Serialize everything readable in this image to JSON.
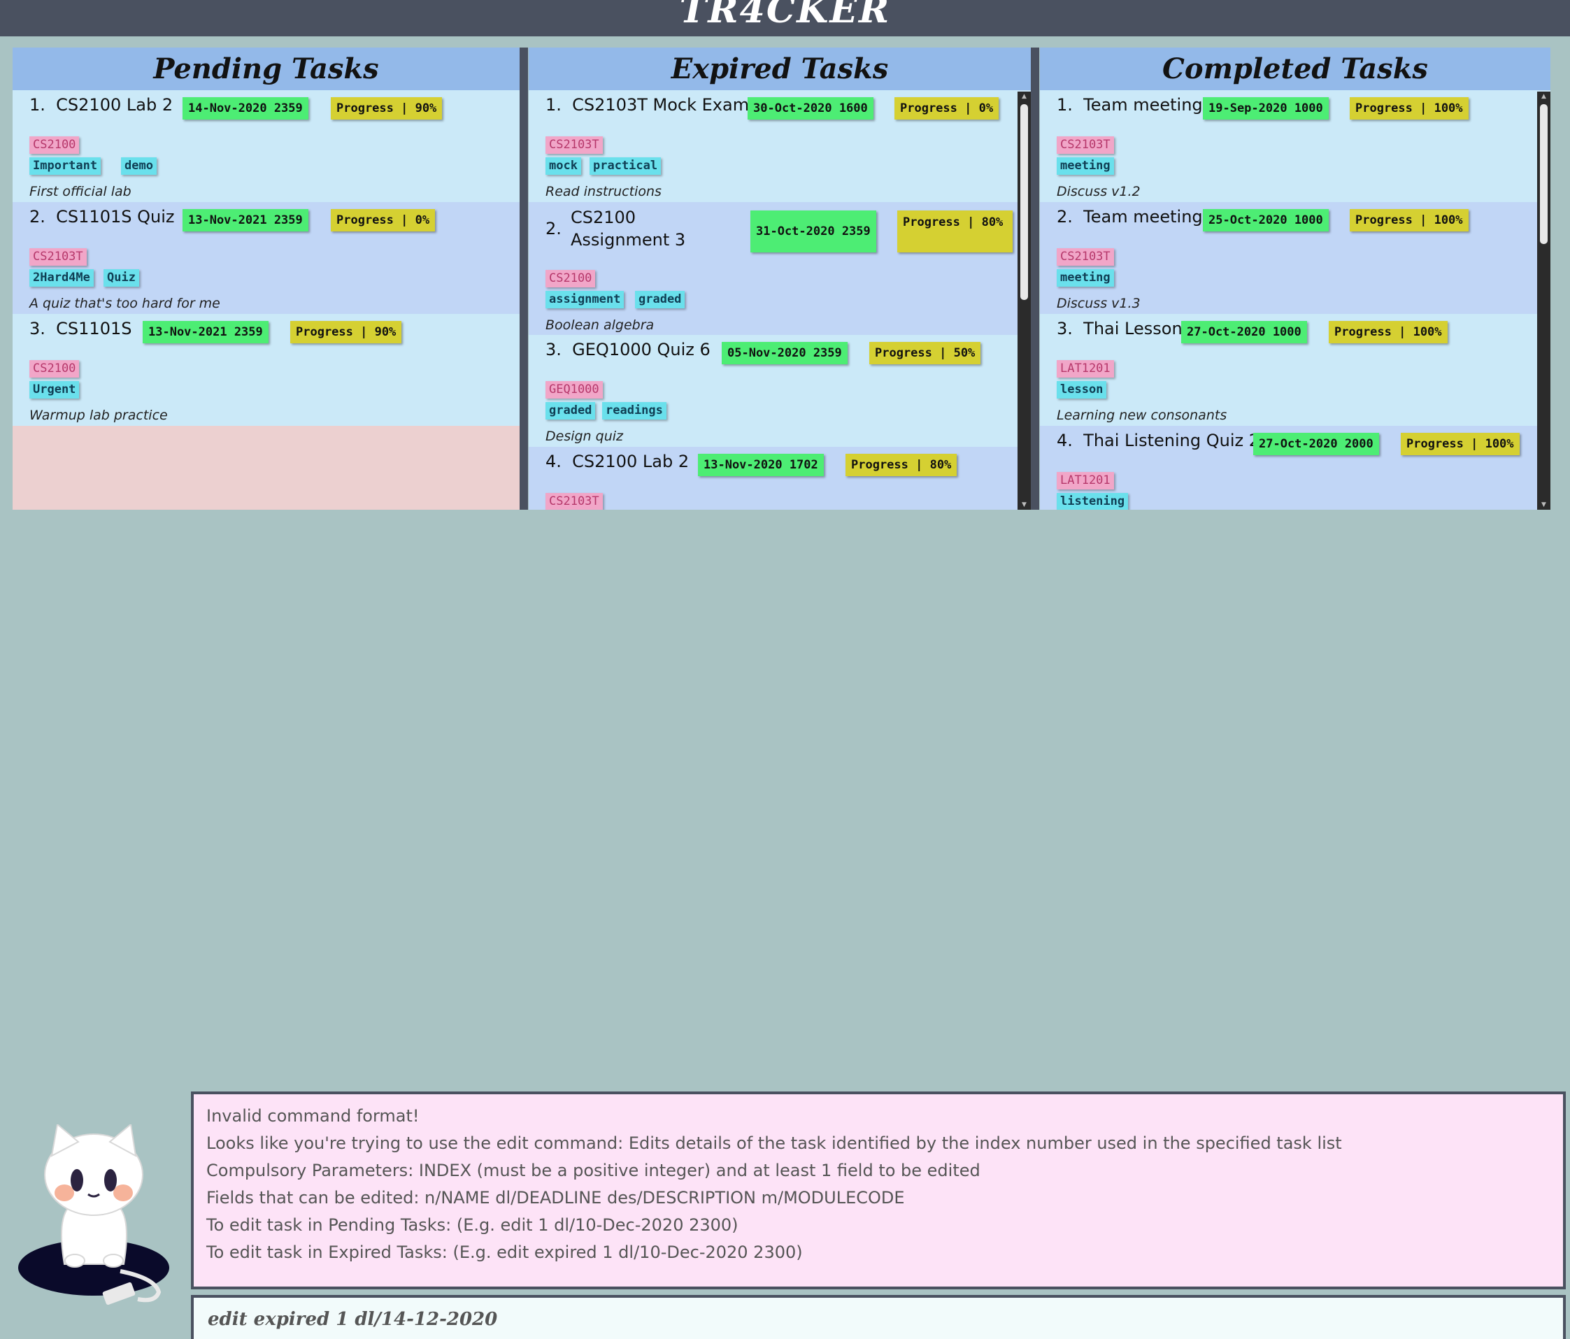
{
  "app": {
    "title": "TR4CKER"
  },
  "pending": {
    "title": "Pending Tasks",
    "tasks": [
      {
        "index": "1.",
        "name": "CS2100 Lab 2",
        "deadline": "14-Nov-2020 2359",
        "progress": "Progress | 90%",
        "module": "CS2100",
        "tags": [
          "Important",
          "demo"
        ],
        "description": "First official lab"
      },
      {
        "index": "2.",
        "name": "CS1101S Quiz",
        "deadline": "13-Nov-2021 2359",
        "progress": "Progress | 0%",
        "module": "CS2103T",
        "tags": [
          "2Hard4Me",
          "Quiz"
        ],
        "description": "A quiz that's too hard for me"
      },
      {
        "index": "3.",
        "name": "CS1101S",
        "deadline": "13-Nov-2021 2359",
        "progress": "Progress | 90%",
        "module": "CS2100",
        "tags": [
          "Urgent"
        ],
        "description": "Warmup lab practice"
      }
    ]
  },
  "expired": {
    "title": "Expired Tasks",
    "tasks": [
      {
        "index": "1.",
        "name": "CS2103T Mock Exam",
        "deadline": "30-Oct-2020 1600",
        "progress": "Progress | 0%",
        "module": "CS2103T",
        "tags": [
          "mock",
          "practical"
        ],
        "description": "Read instructions"
      },
      {
        "index": "2.",
        "name": "CS2100 Assignment 3",
        "deadline": "31-Oct-2020 2359",
        "progress": "Progress | 80%",
        "module": "CS2100",
        "tags": [
          "assignment",
          "graded"
        ],
        "description": "Boolean algebra"
      },
      {
        "index": "3.",
        "name": "GEQ1000 Quiz 6",
        "deadline": "05-Nov-2020 2359",
        "progress": "Progress | 50%",
        "module": "GEQ1000",
        "tags": [
          "graded",
          "readings"
        ],
        "description": "Design quiz"
      },
      {
        "index": "4.",
        "name": "CS2100 Lab 2",
        "deadline": "13-Nov-2020 1702",
        "progress": "Progress | 80%",
        "module": "CS2103T",
        "tags": [
          "",
          ""
        ],
        "description": ""
      }
    ]
  },
  "completed": {
    "title": "Completed Tasks",
    "tasks": [
      {
        "index": "1.",
        "name": "Team meeting",
        "deadline": "19-Sep-2020 1000",
        "progress": "Progress | 100%",
        "module": "CS2103T",
        "tags": [
          "meeting"
        ],
        "description": "Discuss v1.2"
      },
      {
        "index": "2.",
        "name": "Team meeting",
        "deadline": "25-Oct-2020 1000",
        "progress": "Progress | 100%",
        "module": "CS2103T",
        "tags": [
          "meeting"
        ],
        "description": "Discuss v1.3"
      },
      {
        "index": "3.",
        "name": "Thai Lesson",
        "deadline": "27-Oct-2020 1000",
        "progress": "Progress | 100%",
        "module": "LAT1201",
        "tags": [
          "lesson"
        ],
        "description": "Learning new consonants"
      },
      {
        "index": "4.",
        "name": "Thai Listening Quiz 2",
        "deadline": "27-Oct-2020 2000",
        "progress": "Progress | 100%",
        "module": "LAT1201",
        "tags": [
          "listening"
        ],
        "description": ""
      }
    ]
  },
  "result": {
    "lines": [
      "Invalid command format!",
      "Looks like you're trying to use the edit command: Edits details of the task identified by the index number used in the specified task list",
      "Compulsory Parameters: INDEX (must be a positive integer) and at least 1 field to be edited",
      "Fields that can be edited: n/NAME dl/DEADLINE des/DESCRIPTION m/MODULECODE",
      "To edit task in Pending Tasks: (E.g. edit 1 dl/10-Dec-2020 2300)",
      "To edit task in Expired Tasks: (E.g. edit expired 1 dl/10-Dec-2020 2300)"
    ]
  },
  "command": {
    "value": "edit expired 1 dl/14-12-2020"
  },
  "colors": {
    "background": "#a9c3c3",
    "header": "#4a5160",
    "panel_header": "#93b9e9",
    "deadline": "#4ded74",
    "progress": "#d5d032",
    "module_tag": "#f1a6c8",
    "tag": "#6ae0ec",
    "result_bg": "#fde3f7"
  }
}
